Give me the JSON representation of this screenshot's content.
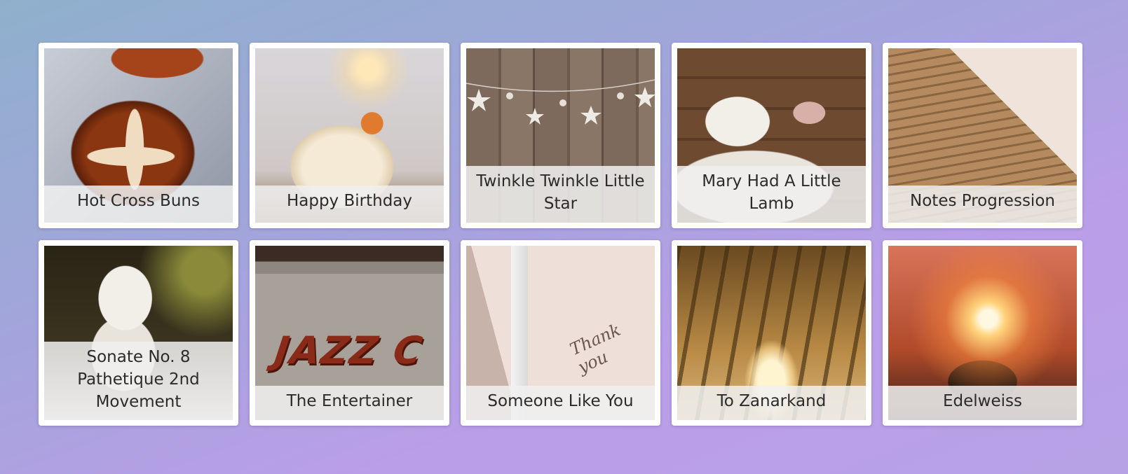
{
  "songs": [
    {
      "title": "Hot Cross Buns",
      "art": "hot-cross-buns-photo"
    },
    {
      "title": "Happy Birthday",
      "art": "birthday-cake-photo"
    },
    {
      "title": "Twinkle Twinkle Little Star",
      "art": "stars-garland-photo"
    },
    {
      "title": "Mary Had A Little Lamb",
      "art": "lamb-photo"
    },
    {
      "title": "Notes Progression",
      "art": "stairs-photo"
    },
    {
      "title": "Sonate No. 8 Pathetique 2nd Movement",
      "art": "beethoven-bust-photo"
    },
    {
      "title": "The Entertainer",
      "art": "jazz-sign-photo"
    },
    {
      "title": "Someone Like You",
      "art": "thank-you-card-photo"
    },
    {
      "title": "To Zanarkand",
      "art": "forest-tunnel-photo"
    },
    {
      "title": "Edelweiss",
      "art": "sunlight-flower-photo"
    }
  ],
  "colors": {
    "background_start": "#8fb0cc",
    "background_end": "#b7a2e6",
    "card": "#ffffff",
    "caption_bg": "#f0f0f0",
    "caption_text": "#2b2b2b"
  }
}
